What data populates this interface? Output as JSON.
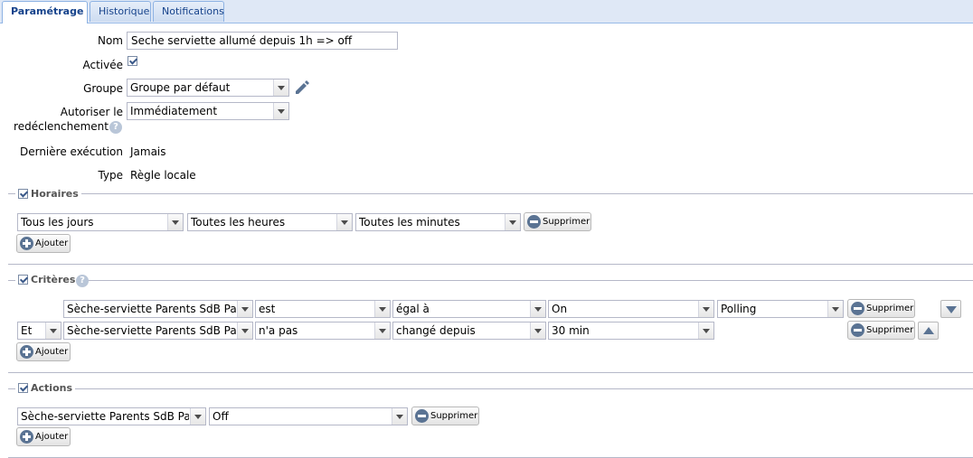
{
  "tabs": [
    {
      "label": "Paramétrage"
    },
    {
      "label": "Historique"
    },
    {
      "label": "Notifications"
    }
  ],
  "form": {
    "name_label": "Nom",
    "name_value": "Seche serviette allumé depuis 1h => off",
    "enabled_label": "Activée",
    "enabled_checked": true,
    "group_label": "Groupe",
    "group_value": "Groupe par défaut",
    "retrigger_label_1": "Autoriser le",
    "retrigger_label_2": "redéclenchement",
    "retrigger_value": "Immédiatement",
    "last_exec_label": "Dernière exécution",
    "last_exec_value": "Jamais",
    "type_label": "Type",
    "type_value": "Règle locale",
    "help_glyph": "?"
  },
  "schedule": {
    "legend": "Horaires",
    "checked": true,
    "days": "Tous les jours",
    "hours": "Toutes les heures",
    "minutes": "Toutes les minutes",
    "remove_label": "Supprimer",
    "add_label": "Ajouter"
  },
  "criteria": {
    "legend": "Critères",
    "checked": true,
    "rows": [
      {
        "conj": "",
        "device": "Sèche-serviette Parents SdB Pare",
        "verb": "est",
        "op": "égal à",
        "value": "On",
        "mode": "Polling",
        "remove": "Supprimer"
      },
      {
        "conj": "Et",
        "device": "Sèche-serviette Parents SdB Pare",
        "verb": "n'a pas",
        "op": "changé depuis",
        "value": "30 min",
        "mode": "",
        "remove": "Supprimer"
      }
    ],
    "add_label": "Ajouter"
  },
  "actions": {
    "legend": "Actions",
    "checked": true,
    "device": "Sèche-serviette Parents SdB Pare",
    "value": "Off",
    "remove_label": "Supprimer",
    "add_label": "Ajouter"
  },
  "icons": {
    "edit": "pencil-icon",
    "help": "help-icon",
    "remove": "minus-circle-icon",
    "add": "plus-circle-icon",
    "move_down": "arrow-down-icon",
    "move_up": "arrow-up-icon"
  }
}
